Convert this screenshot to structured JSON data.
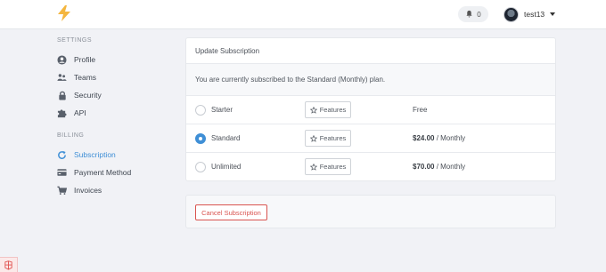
{
  "header": {
    "notifications_count": "0",
    "username": "test13"
  },
  "sidebar": {
    "settings_heading": "SETTINGS",
    "settings_items": [
      {
        "label": "Profile",
        "icon": "user-circle-icon"
      },
      {
        "label": "Teams",
        "icon": "users-icon"
      },
      {
        "label": "Security",
        "icon": "lock-icon"
      },
      {
        "label": "API",
        "icon": "puzzle-icon"
      }
    ],
    "billing_heading": "BILLING",
    "billing_items": [
      {
        "label": "Subscription",
        "icon": "refresh-icon",
        "active": true
      },
      {
        "label": "Payment Method",
        "icon": "credit-card-icon"
      },
      {
        "label": "Invoices",
        "icon": "shopping-cart-icon"
      }
    ]
  },
  "subscription": {
    "title": "Update Subscription",
    "current_text": "You are currently subscribed to the Standard (Monthly) plan.",
    "features_label": "Features",
    "plans": [
      {
        "name": "Starter",
        "price": "Free",
        "per": "",
        "selected": false
      },
      {
        "name": "Standard",
        "price": "$24.00",
        "per": " / Monthly",
        "selected": true
      },
      {
        "name": "Unlimited",
        "price": "$70.00",
        "per": " / Monthly",
        "selected": false
      }
    ]
  },
  "cancel": {
    "button_label": "Cancel Subscription"
  },
  "colors": {
    "accent": "#3f8fd6",
    "danger": "#d9534f",
    "logo": "#f4b63f"
  }
}
